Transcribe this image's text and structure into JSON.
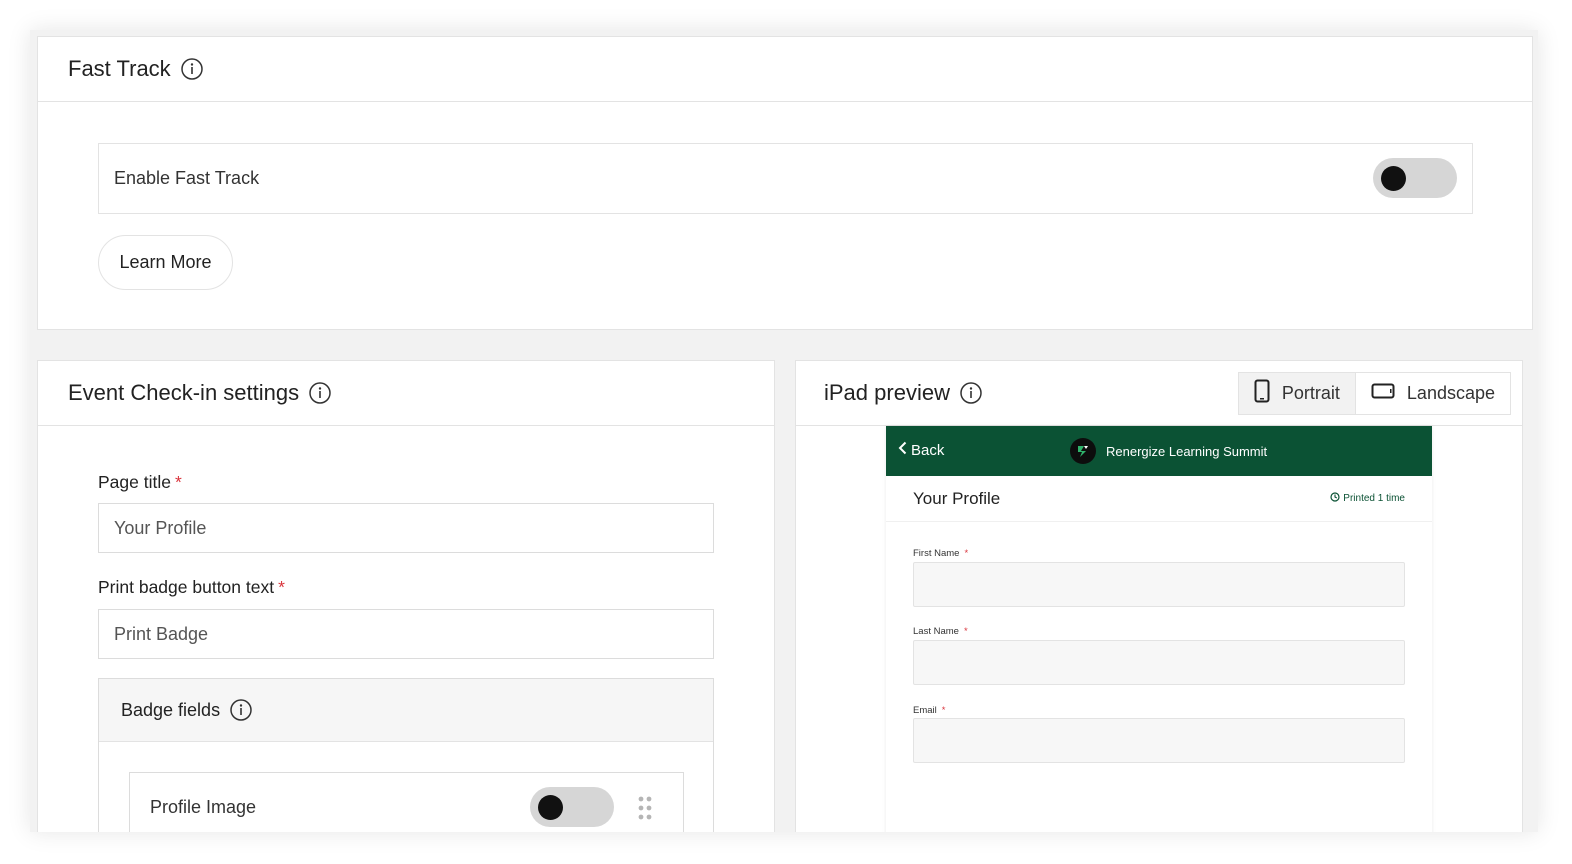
{
  "fast_track": {
    "title": "Fast Track",
    "enable_label": "Enable Fast Track",
    "enabled": false,
    "learn_more_label": "Learn More"
  },
  "checkin": {
    "title": "Event Check-in settings",
    "page_title_label": "Page title",
    "page_title_value": "Your Profile",
    "print_button_label": "Print badge button text",
    "print_button_value": "Print Badge",
    "required_mark": "*",
    "badge_fields": {
      "title": "Badge fields",
      "items": [
        {
          "label": "Profile Image",
          "enabled": false
        }
      ]
    }
  },
  "ipad_preview": {
    "title": "iPad preview",
    "orientation": {
      "portrait_label": "Portrait",
      "landscape_label": "Landscape",
      "selected": "Portrait"
    },
    "device": {
      "back_label": "Back",
      "event_name": "Renergize Learning Summit",
      "page_title": "Your Profile",
      "printed_status": "Printed 1 time",
      "fields": [
        {
          "label": "First Name"
        },
        {
          "label": "Last Name"
        },
        {
          "label": "Email"
        }
      ]
    }
  },
  "colors": {
    "brand_green": "#0b5234",
    "required_red": "#d9363e",
    "toggle_off_track": "#d6d6d6"
  }
}
